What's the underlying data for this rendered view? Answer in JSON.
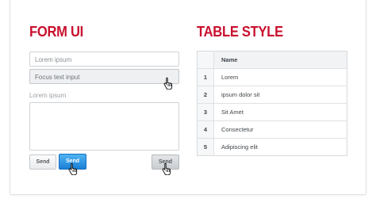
{
  "form": {
    "heading": "FORM UI",
    "input1_placeholder": "Lorem ipsum",
    "input2_value": "Focus text input",
    "label": "Lorem ipsum",
    "buttons": {
      "plain": "Send",
      "blue": "Send",
      "gray": "Send"
    }
  },
  "table": {
    "heading": "TABLE STYLE",
    "columns": [
      "",
      "Name"
    ],
    "rows": [
      {
        "num": "1",
        "name": "Lorem"
      },
      {
        "num": "2",
        "name": "ipsum dolor sit"
      },
      {
        "num": "3",
        "name": "Sit Amet"
      },
      {
        "num": "4",
        "name": "Consectetur"
      },
      {
        "num": "5",
        "name": "Adipiscing elit"
      }
    ]
  },
  "colors": {
    "heading": "#c8102e",
    "primary_button": "#1a7fd6"
  },
  "icons": [
    "hand-cursor-icon"
  ]
}
